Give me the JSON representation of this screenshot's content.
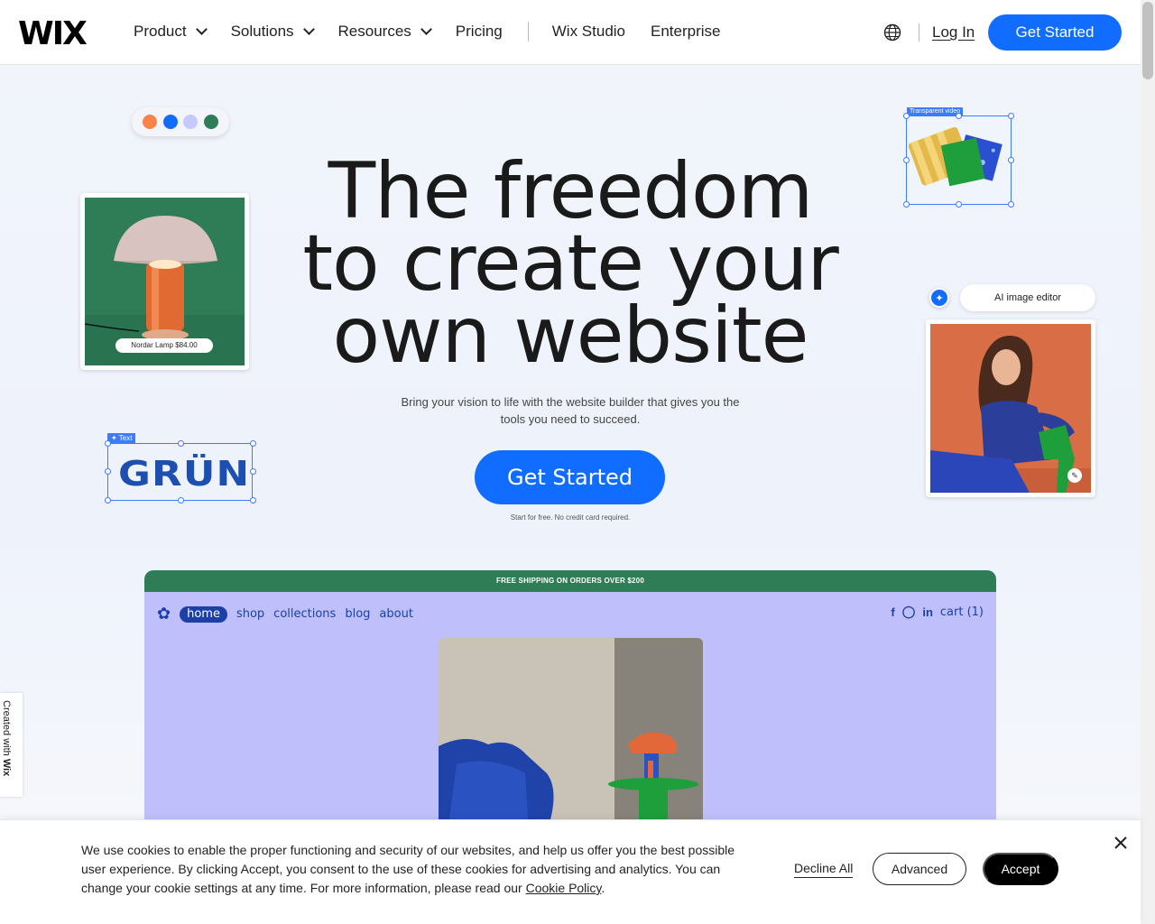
{
  "header": {
    "logo": "WIX",
    "nav": [
      {
        "label": "Product"
      },
      {
        "label": "Solutions"
      },
      {
        "label": "Resources"
      },
      {
        "label": "Pricing"
      },
      {
        "label": "Wix Studio"
      },
      {
        "label": "Enterprise"
      }
    ],
    "login": "Log In",
    "cta": "Get Started"
  },
  "hero": {
    "title_line1": "The freedom",
    "title_line2": "to create your",
    "title_line3": "own website",
    "subtitle": "Bring your vision to life with the website builder that gives you the tools you need to succeed.",
    "cta": "Get Started",
    "note": "Start for free. No credit card required.",
    "dots_colors": [
      "#f9844a",
      "#116dff",
      "#c7c8fb",
      "#2f7d57"
    ],
    "lamp_price": "Nordar Lamp $84.00",
    "text_tag": "Text",
    "brand_text": "GRÜN",
    "video_tag": "Transparent video",
    "ai_label": "AI image editor"
  },
  "preview": {
    "banner": "FREE SHIPPING ON ORDERS OVER $200",
    "nav": [
      "home",
      "shop",
      "collections",
      "blog",
      "about"
    ],
    "cart": "cart (1)"
  },
  "created_with": {
    "prefix": "Created with ",
    "brand": "Wix"
  },
  "cookie": {
    "text": "We use cookies to enable the proper functioning and security of our websites, and help us offer you the best possible user experience. By clicking Accept, you consent to the use of these cookies for advertising and analytics. You can change your cookie settings at any time. For more information, please read our ",
    "link": "Cookie Policy",
    "decline": "Decline All",
    "advanced": "Advanced",
    "accept": "Accept"
  },
  "colors": {
    "accent": "#116dff",
    "brand_green": "#2f7d57",
    "preview_bg": "#bfc0fb"
  }
}
